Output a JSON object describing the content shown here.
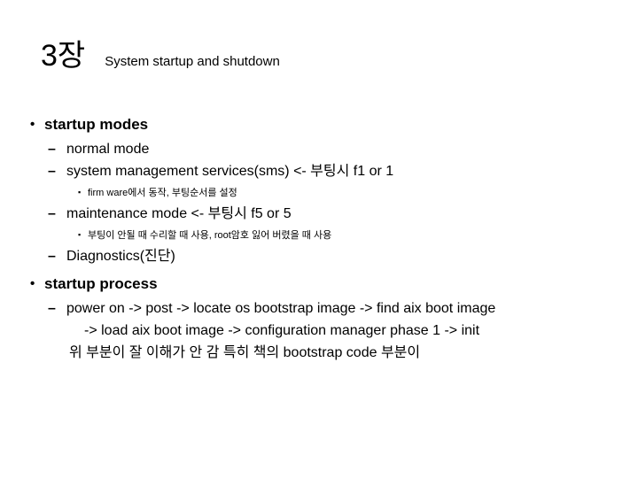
{
  "slide": {
    "title": "3장",
    "subtitle": "System startup and shutdown",
    "background_color": "#ffffff",
    "text_color": "#000000",
    "bullets": {
      "level1": "•",
      "level2": "–",
      "level3": "▪"
    },
    "outline": [
      {
        "level": 1,
        "text": "startup modes"
      },
      {
        "level": 2,
        "text": "normal mode"
      },
      {
        "level": 2,
        "text": "system management services(sms) <- 부팅시 f1 or 1"
      },
      {
        "level": 3,
        "text": "firm ware에서 동작, 부팅순서를 설정"
      },
      {
        "level": 2,
        "text": "maintenance mode <- 부팅시 f5 or 5"
      },
      {
        "level": 3,
        "text": "부팅이 안될 때 수리할 때 사용, root암호 잃어 버렸을 때 사용"
      },
      {
        "level": 2,
        "text": "Diagnostics(진단)"
      },
      {
        "level": 1,
        "text": "startup process"
      },
      {
        "level": 2,
        "text": "power on -> post -> locate os bootstrap image -> find aix boot image"
      },
      {
        "level": "continuation",
        "text": "-> load aix boot image -> configuration manager phase 1 -> init"
      },
      {
        "level": "remark",
        "text": "위 부분이 잘 이해가 안 감 특히 책의 bootstrap code 부분이"
      }
    ]
  }
}
